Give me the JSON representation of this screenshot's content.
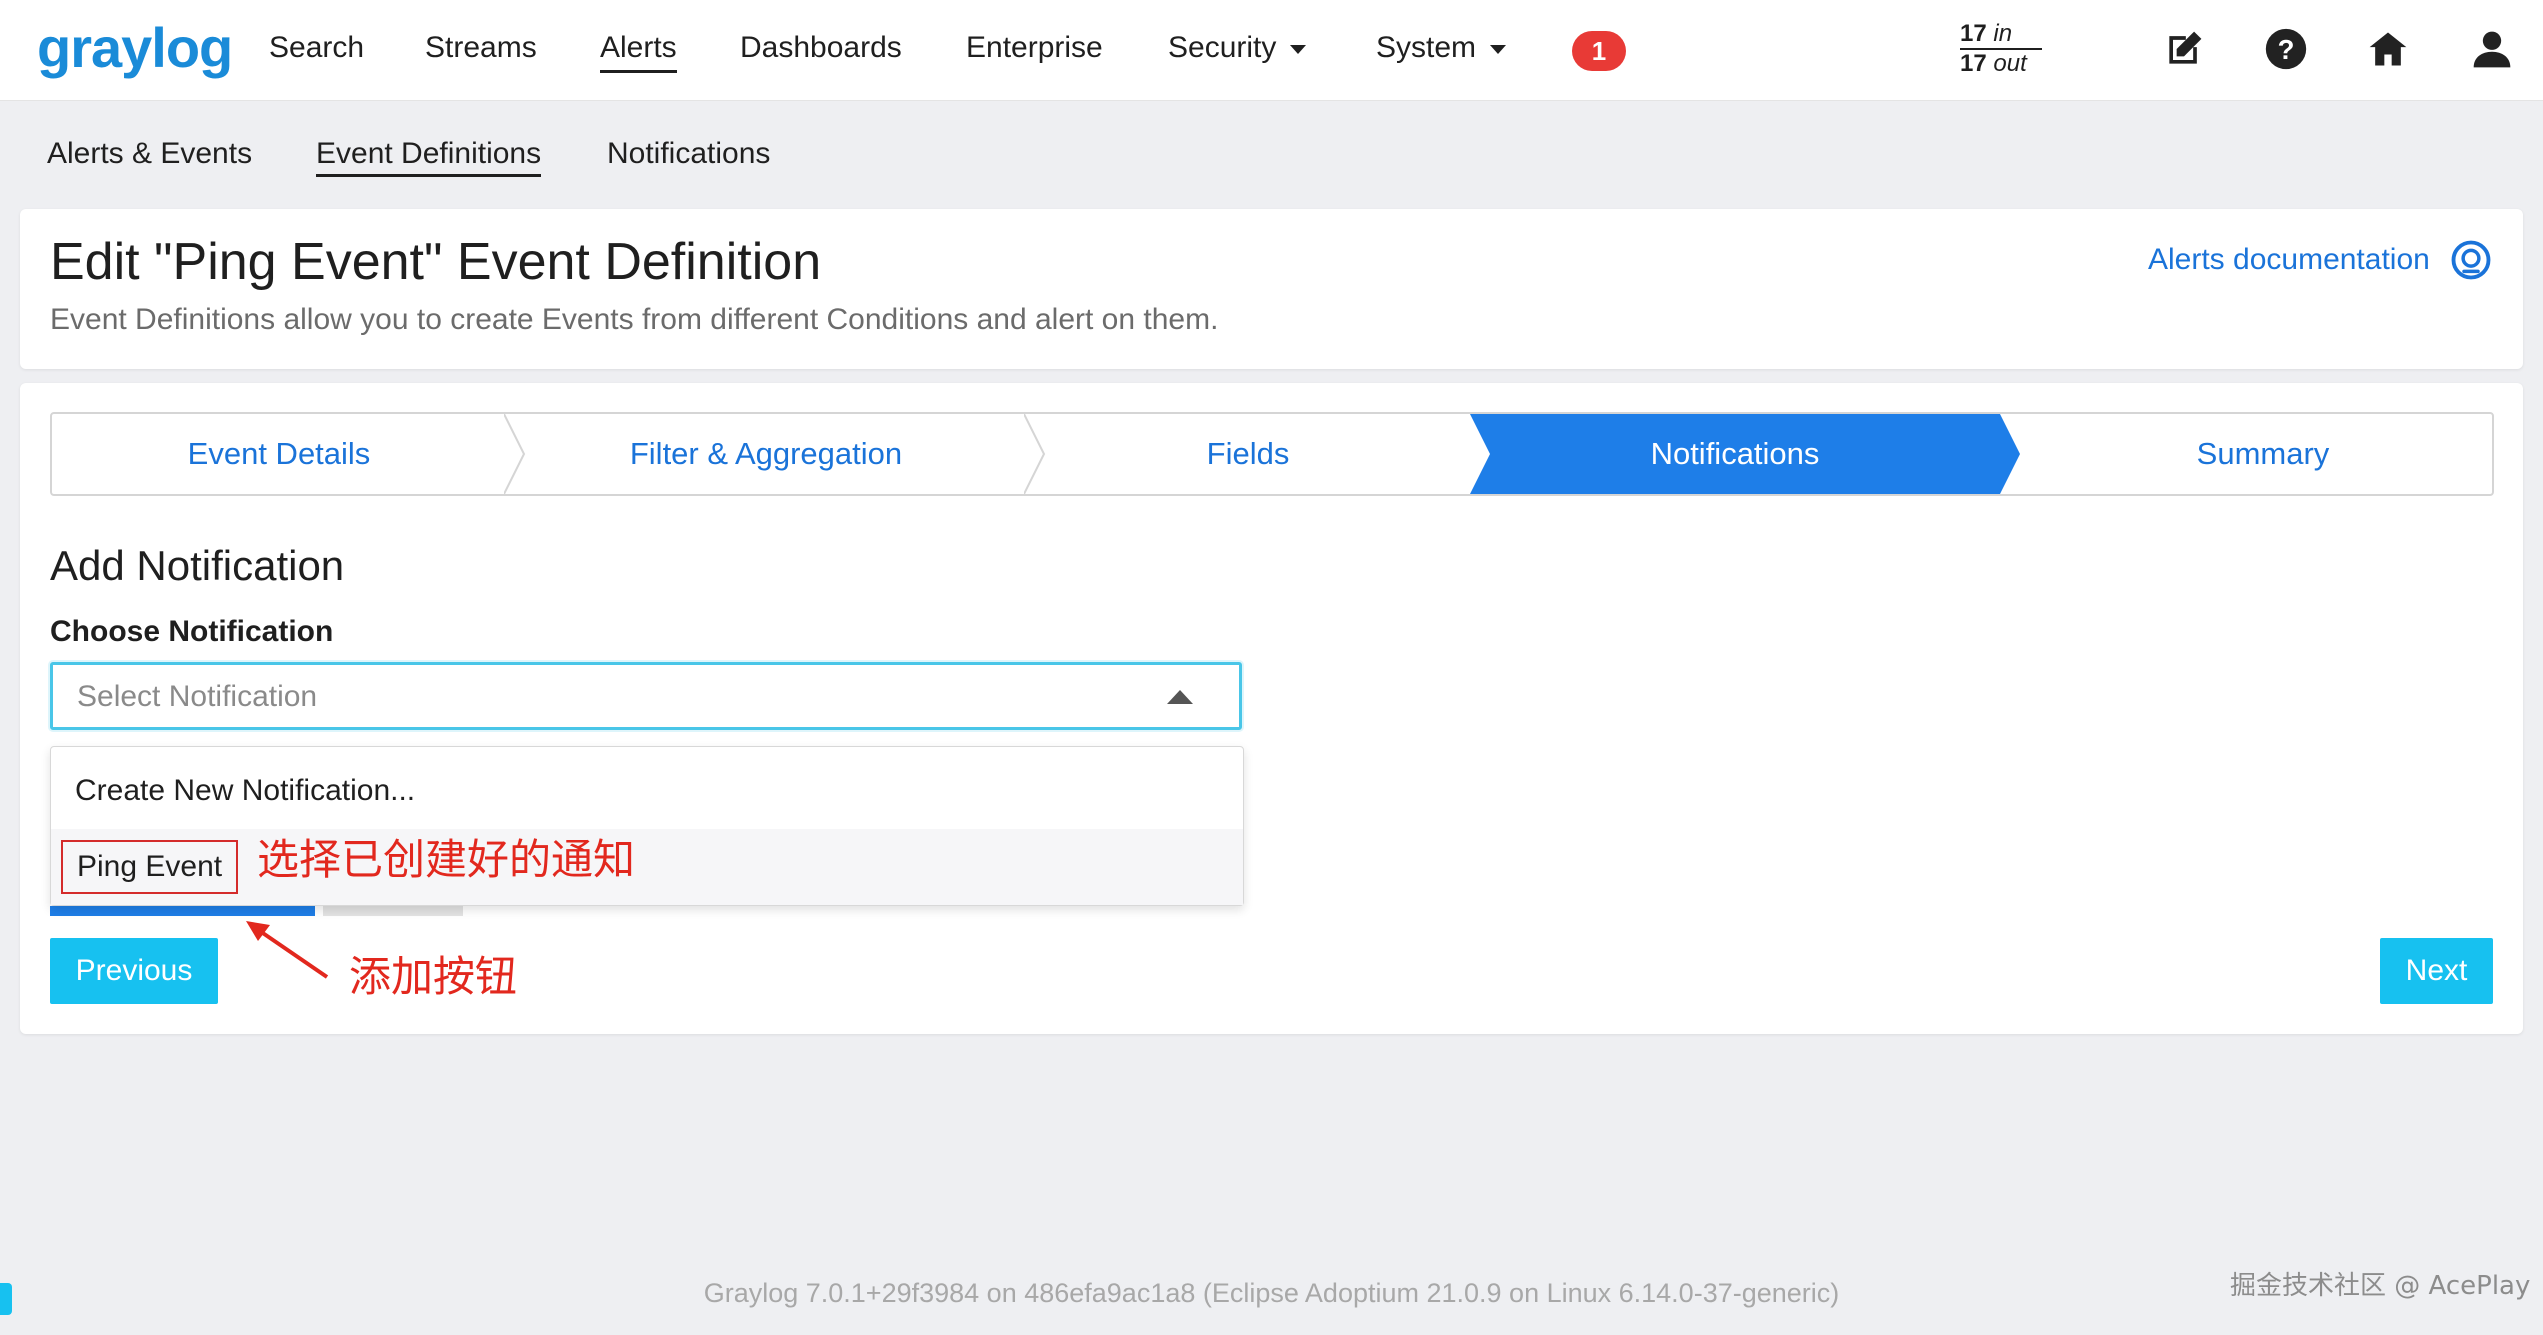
{
  "brand": {
    "logo_text": "graylog"
  },
  "nav": {
    "items": [
      {
        "label": "Search"
      },
      {
        "label": "Streams"
      },
      {
        "label": "Alerts"
      },
      {
        "label": "Dashboards"
      },
      {
        "label": "Enterprise"
      },
      {
        "label": "Security"
      },
      {
        "label": "System"
      }
    ],
    "notification_count": "1",
    "throughput_in": "17",
    "throughput_in_label": "in",
    "throughput_out": "17",
    "throughput_out_label": "out",
    "icons": [
      "edit-icon",
      "help-icon",
      "home-icon",
      "user-icon"
    ]
  },
  "subnav": {
    "items": [
      {
        "label": "Alerts & Events"
      },
      {
        "label": "Event Definitions"
      },
      {
        "label": "Notifications"
      }
    ]
  },
  "header": {
    "title": "Edit \"Ping Event\" Event Definition",
    "description": "Event Definitions allow you to create Events from different Conditions and alert on them.",
    "doc_link": "Alerts documentation"
  },
  "wizard": {
    "steps": [
      {
        "label": "Event Details"
      },
      {
        "label": "Filter & Aggregation"
      },
      {
        "label": "Fields"
      },
      {
        "label": "Notifications"
      },
      {
        "label": "Summary"
      }
    ],
    "active_step": "Notifications"
  },
  "form": {
    "section_title": "Add Notification",
    "field_label": "Choose Notification",
    "select_placeholder": "Select Notification",
    "options": [
      {
        "label": "Create New Notification..."
      },
      {
        "label": "Ping Event"
      }
    ]
  },
  "annotations": {
    "select_note": "选择已创建好的通知",
    "add_button_note": "添加按钮"
  },
  "buttons": {
    "previous": "Previous",
    "next": "Next"
  },
  "footer": {
    "version": "Graylog 7.0.1+29f3984 on 486efa9ac1a8 (Eclipse Adoptium 21.0.9 on Linux 6.14.0-37-generic)",
    "watermark": "掘金技术社区 @ AcePlay"
  },
  "colors": {
    "accent": "#1e7ee8",
    "cyan_button": "#17c1f0",
    "badge": "#e83a36",
    "annotation": "#e2281e",
    "link": "#1a73d9"
  }
}
